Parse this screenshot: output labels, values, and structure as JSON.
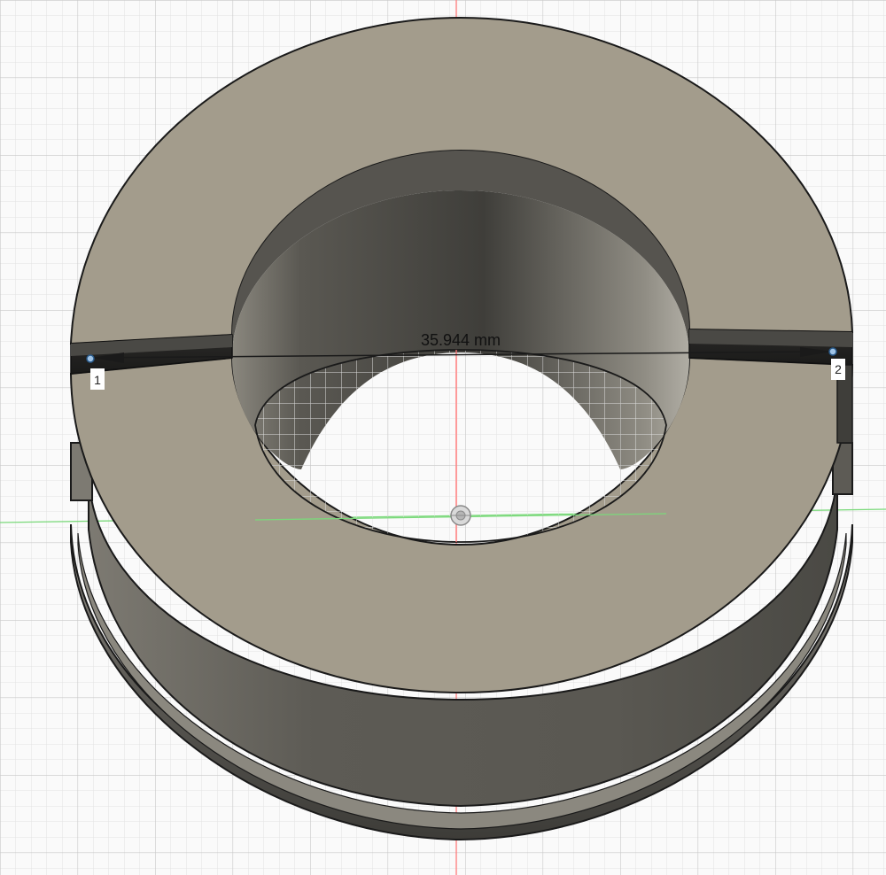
{
  "measurement": {
    "value_text": "35.944 mm",
    "point_1_label": "1",
    "point_2_label": "2"
  },
  "colors": {
    "background": "#fafafa",
    "grid_minor": "#e0e0e0",
    "grid_major": "#c9c9c9",
    "axis_red": "#ff6b6b",
    "axis_green": "#6fd36f",
    "face_top": "#a39c8c",
    "side_wall": "#6d6a63",
    "edge": "#1a1a1a"
  },
  "icons": {
    "origin": "origin-icon",
    "measure_point": "measure-point-icon"
  }
}
